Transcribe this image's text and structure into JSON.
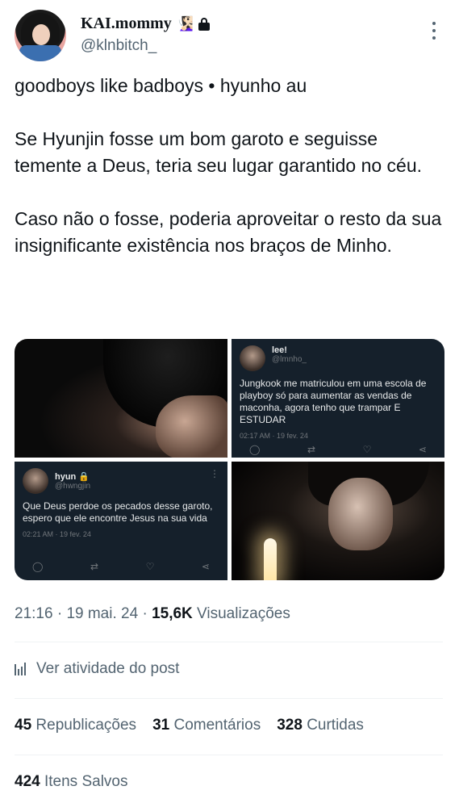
{
  "author": {
    "display_name": "KAI.mommy",
    "emoji": "🧏🏻‍♀️",
    "handle": "@klnbitch_"
  },
  "tweet": {
    "lines": [
      "goodboys like badboys • hyunho au",
      "Se Hyunjin fosse um bom garoto e seguisse temente a Deus, teria seu lugar garantido no céu.",
      "Caso não o fosse, poderia aproveitar o resto da sua insignificante existência nos braços de Minho."
    ]
  },
  "media": {
    "tile2": {
      "name": "lee!",
      "handle": "@lmnho_",
      "text": "Jungkook me matriculou em uma escola de playboy só para aumentar as vendas de maconha, agora tenho que trampar E ESTUDAR",
      "time": "02:17 AM · 19 fev. 24"
    },
    "tile3": {
      "name": "hyun",
      "handle": "@hwngjin",
      "text": "Que Deus perdoe os pecados desse garoto, espero que ele encontre Jesus na sua vida",
      "time": "02:21 AM · 19 fev. 24"
    }
  },
  "meta": {
    "time": "21:16",
    "date": "19 mai. 24",
    "views_count": "15,6K",
    "views_label": "Visualizações",
    "separator": "·"
  },
  "activity_label": "Ver atividade do post",
  "stats": {
    "reposts_count": "45",
    "reposts_label": "Republicações",
    "comments_count": "31",
    "comments_label": "Comentários",
    "likes_count": "328",
    "likes_label": "Curtidas",
    "saves_count": "424",
    "saves_label": "Itens Salvos"
  }
}
